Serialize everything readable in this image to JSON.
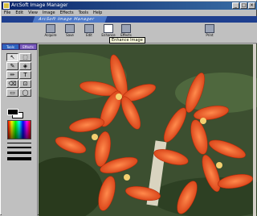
{
  "window": {
    "title": "ArcSoft Image Manager"
  },
  "menu": [
    "File",
    "Edit",
    "View",
    "Image",
    "Effects",
    "Tools",
    "Help"
  ],
  "banner": {
    "tab": "ArcSoft Image Manager"
  },
  "toolbar": {
    "buttons": [
      {
        "label": "Acquire",
        "icon": "acquire-icon"
      },
      {
        "label": "Save",
        "icon": "save-icon"
      },
      {
        "label": "Edit",
        "icon": "edit-icon"
      },
      {
        "label": "Enhance",
        "icon": "enhance-icon"
      },
      {
        "label": "Effects",
        "icon": "effects-icon"
      },
      {
        "label": "Print",
        "icon": "print-icon"
      }
    ],
    "tooltip": "Enhance Image"
  },
  "side_tabs": [
    "Tools",
    "Effects"
  ],
  "tools": [
    "select",
    "lasso",
    "brush",
    "fill",
    "pen",
    "text",
    "eraser",
    "crop",
    "rectangle",
    "ellipse"
  ],
  "tool_glyphs": [
    "↖",
    "⬚",
    "✎",
    "◈",
    "✏",
    "T",
    "⌫",
    "⊡",
    "▭",
    "◯"
  ],
  "colors": {
    "foreground": "#000000",
    "background": "#ffffff",
    "titlebar": "#0a246a"
  }
}
